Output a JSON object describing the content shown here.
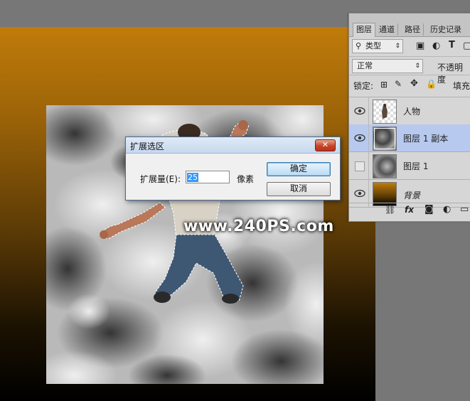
{
  "layers_panel": {
    "tabs": [
      "图层",
      "通道",
      "路径",
      "历史记录"
    ],
    "filter_kind": "类型",
    "blend_mode": "正常",
    "opacity_label": "不透明度",
    "lock_label": "锁定:",
    "fill_label": "填充",
    "layers": [
      {
        "name": "人物",
        "visible": true,
        "selected": false
      },
      {
        "name": "图层 1 副本",
        "visible": true,
        "selected": true
      },
      {
        "name": "图层 1",
        "visible": false,
        "selected": false
      },
      {
        "name": "背景",
        "visible": true,
        "selected": false,
        "italic": true
      }
    ],
    "footer_icons": [
      "link-icon",
      "fx-icon",
      "mask-icon",
      "adjustment-icon",
      "group-icon"
    ],
    "fx_label": "fx"
  },
  "dialog": {
    "title": "扩展选区",
    "close_symbol": "✕",
    "amount_label": "扩展量(E):",
    "amount_value": "25",
    "unit": "像素",
    "ok_label": "确定",
    "cancel_label": "取消"
  },
  "canvas": {
    "watermark": "www.240PS.com",
    "colors": {
      "gradient_top": "#c07c0a",
      "gradient_bottom": "#000000",
      "selection_color": "#3399ff"
    }
  }
}
